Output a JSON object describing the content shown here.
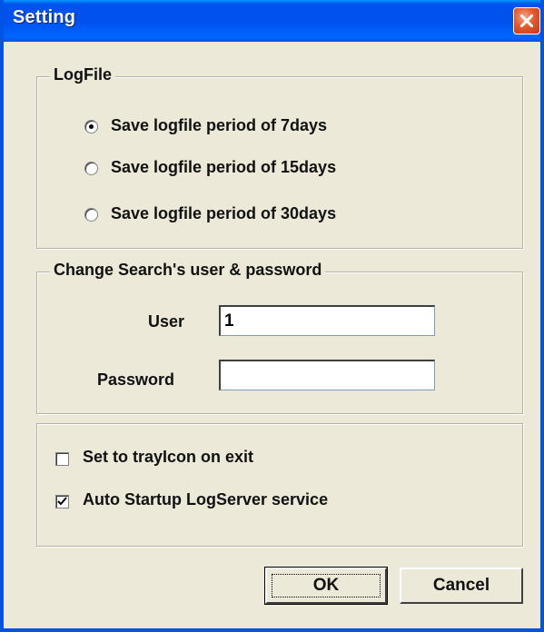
{
  "window": {
    "title": "Setting"
  },
  "logfile": {
    "title": "LogFile",
    "options": [
      {
        "label": "Save logfile period of 7days",
        "selected": true
      },
      {
        "label": "Save logfile period of 15days",
        "selected": false
      },
      {
        "label": "Save logfile period of 30days",
        "selected": false
      }
    ]
  },
  "credentials": {
    "title": "Change Search's user & password",
    "user_label": "User",
    "user_value": "1",
    "password_label": "Password",
    "password_value": ""
  },
  "options": {
    "tray_label": "Set to trayIcon on exit",
    "tray_checked": false,
    "autostart_label": "Auto Startup LogServer service",
    "autostart_checked": true
  },
  "buttons": {
    "ok": "OK",
    "cancel": "Cancel"
  },
  "icons": {
    "close": "close-icon"
  },
  "colors": {
    "titlebar": "#0054e3",
    "close": "#e35a2d",
    "dialog": "#ece9d8"
  }
}
